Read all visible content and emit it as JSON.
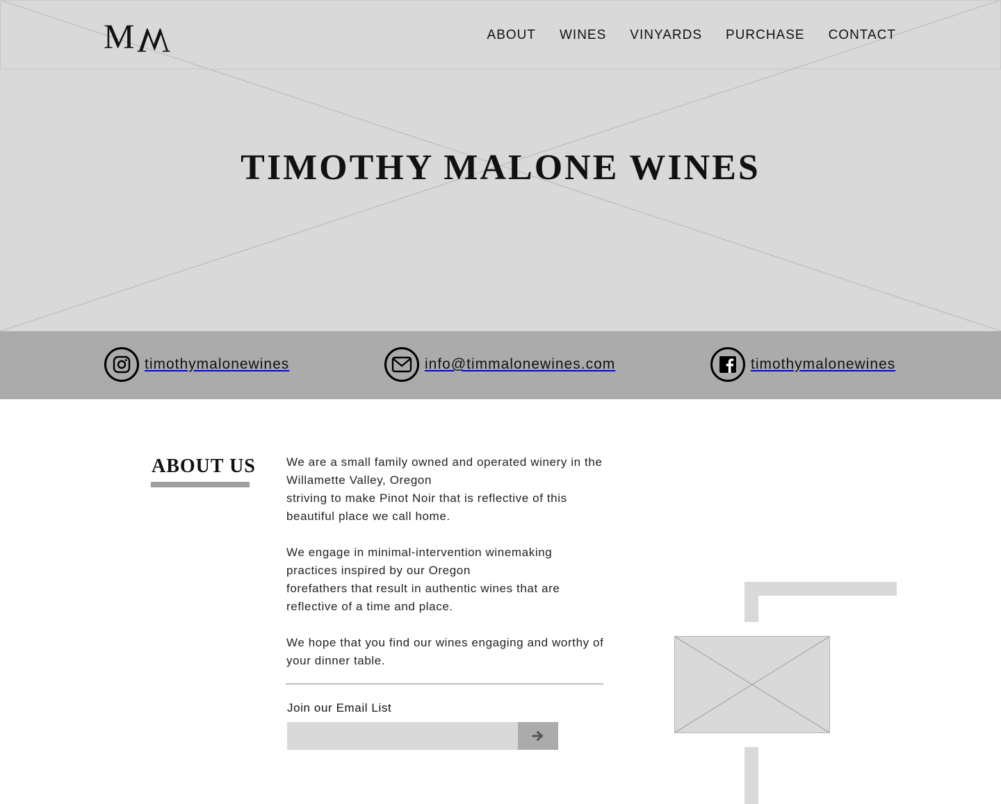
{
  "brand": {
    "logo_left": "M",
    "logo_right": "W",
    "hero_title": "TIMOTHY MALONE WINES"
  },
  "nav": {
    "items": [
      {
        "label": "ABOUT"
      },
      {
        "label": "WINES"
      },
      {
        "label": "VINYARDS"
      },
      {
        "label": "PURCHASE"
      },
      {
        "label": "CONTACT"
      }
    ]
  },
  "contact": {
    "instagram": {
      "icon": "instagram-icon",
      "label": "timothymalonewines"
    },
    "email": {
      "icon": "mail-icon",
      "label": "info@timmalonewines.com"
    },
    "facebook": {
      "icon": "facebook-icon",
      "label": "timothymalonewines"
    }
  },
  "about": {
    "heading": "ABOUT US",
    "paragraphs": [
      [
        "We are a small family owned and operated winery in the Willamette Valley, Oregon",
        "striving to make Pinot Noir that is reflective of this beautiful place we call home."
      ],
      [
        "We engage in minimal-intervention winemaking practices inspired by our Oregon",
        "forefathers that result in authentic wines that are reflective of a time and place."
      ],
      [
        "We hope that you find our wines engaging and worthy of your dinner table."
      ]
    ]
  },
  "email_signup": {
    "label": "Join our Email List",
    "placeholder": "",
    "submit_icon": "arrow-right-icon"
  },
  "colors": {
    "placeholder_gray": "#d9d9d9",
    "bar_gray": "#ababab",
    "underline_gray": "#9e9e9e",
    "text": "#111111"
  }
}
